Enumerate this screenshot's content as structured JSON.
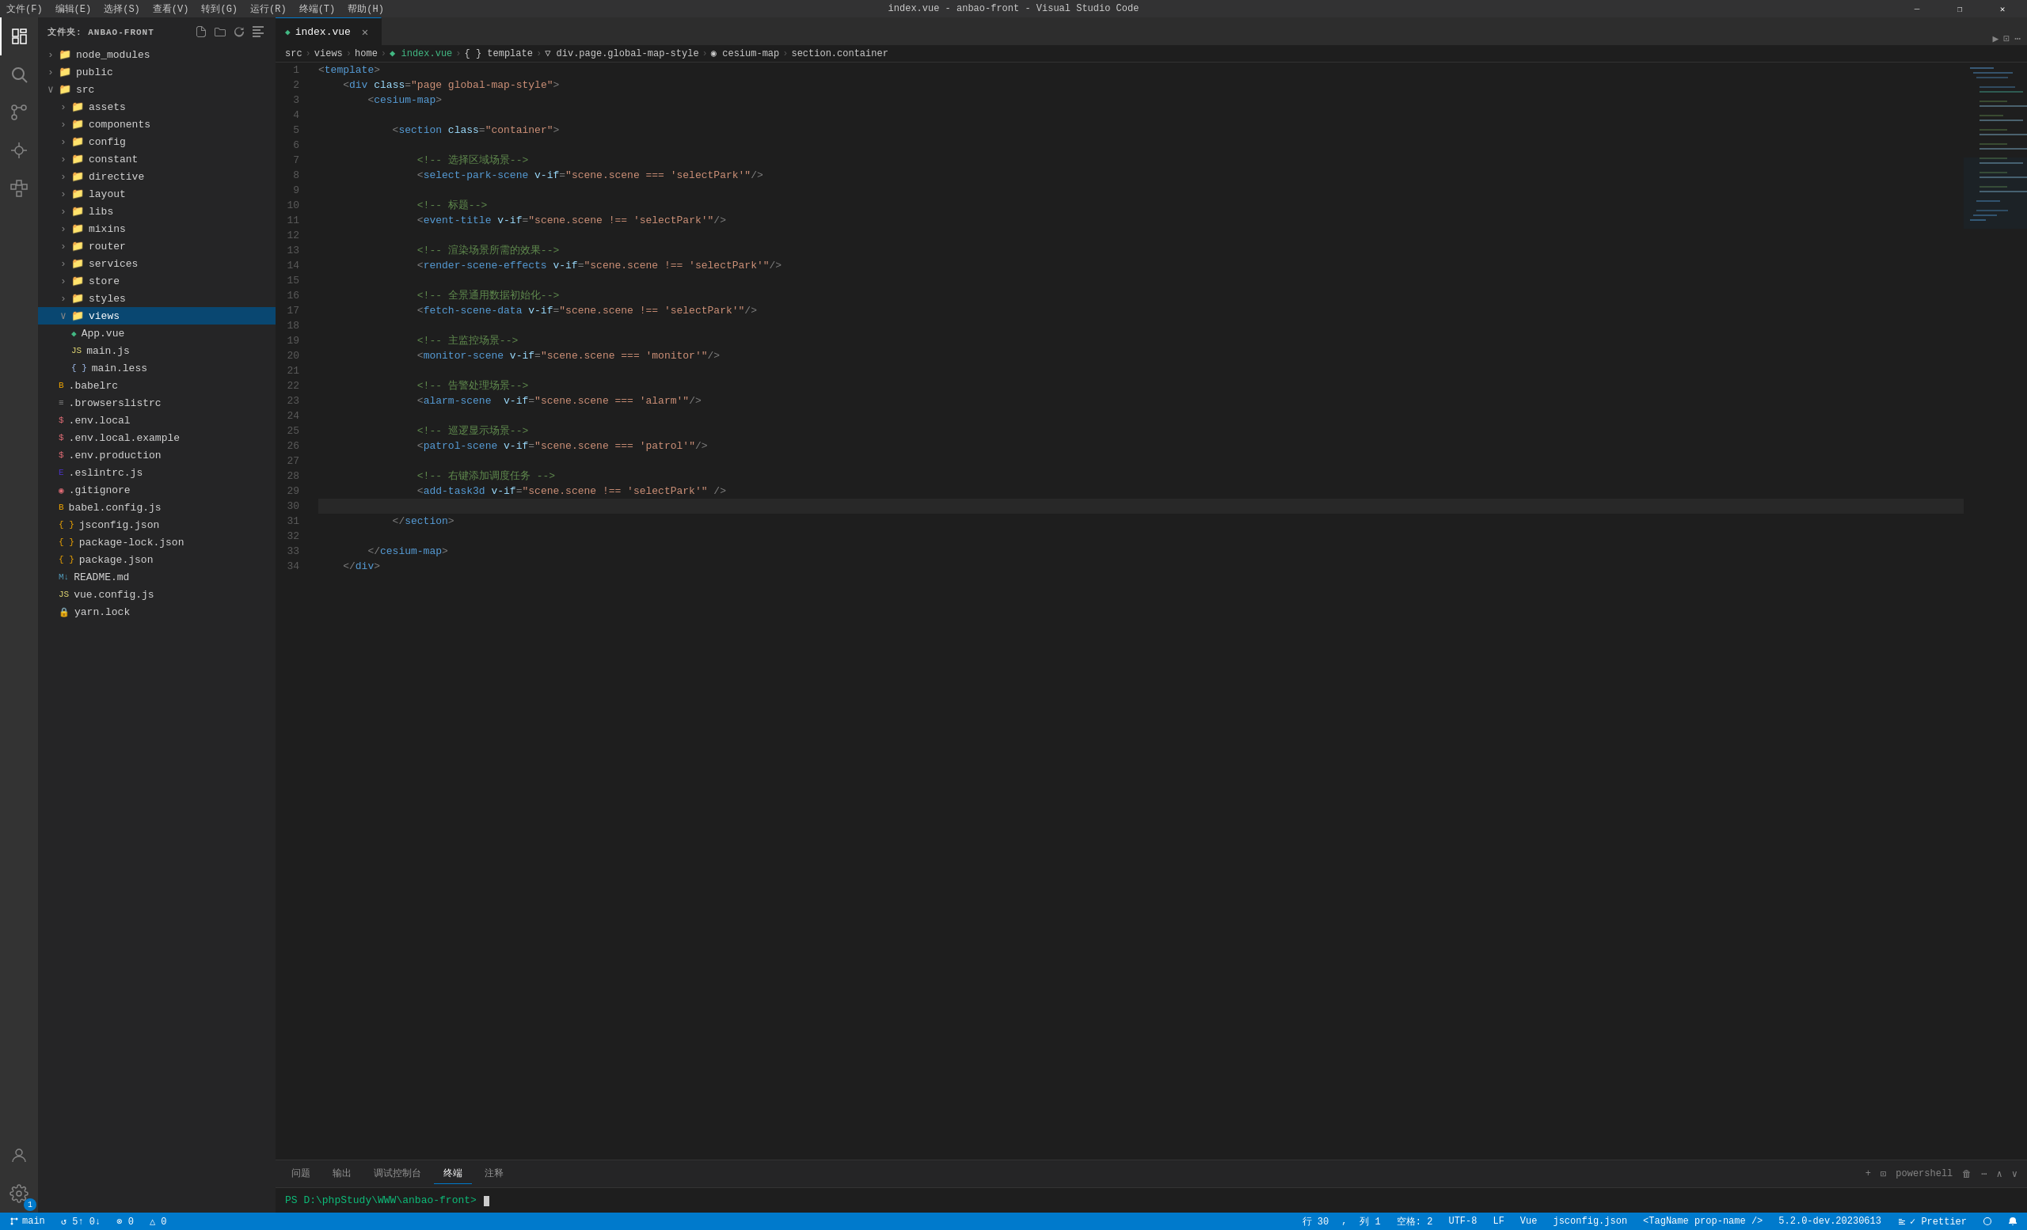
{
  "titleBar": {
    "menus": [
      "文件(F)",
      "编辑(E)",
      "选择(S)",
      "查看(V)",
      "转到(G)",
      "运行(R)",
      "终端(T)",
      "帮助(H)"
    ],
    "title": "index.vue - anbao-front - Visual Studio Code",
    "controls": [
      "—",
      "❐",
      "✕"
    ]
  },
  "sidebar": {
    "header": "文件夹: ANBAO-FRONT",
    "tree": [
      {
        "id": "node_modules",
        "label": "node_modules",
        "type": "folder",
        "depth": 0,
        "collapsed": true
      },
      {
        "id": "public",
        "label": "public",
        "type": "folder",
        "depth": 0,
        "collapsed": true
      },
      {
        "id": "src",
        "label": "src",
        "type": "folder",
        "depth": 0,
        "collapsed": false
      },
      {
        "id": "assets",
        "label": "assets",
        "type": "folder",
        "depth": 1,
        "collapsed": true
      },
      {
        "id": "components",
        "label": "components",
        "type": "folder",
        "depth": 1,
        "collapsed": true
      },
      {
        "id": "config",
        "label": "config",
        "type": "folder",
        "depth": 1,
        "collapsed": true
      },
      {
        "id": "constant",
        "label": "constant",
        "type": "folder",
        "depth": 1,
        "collapsed": true
      },
      {
        "id": "directive",
        "label": "directive",
        "type": "folder",
        "depth": 1,
        "collapsed": true
      },
      {
        "id": "layout",
        "label": "layout",
        "type": "folder",
        "depth": 1,
        "collapsed": true
      },
      {
        "id": "libs",
        "label": "libs",
        "type": "folder",
        "depth": 1,
        "collapsed": true
      },
      {
        "id": "mixins",
        "label": "mixins",
        "type": "folder",
        "depth": 1,
        "collapsed": true
      },
      {
        "id": "router",
        "label": "router",
        "type": "folder",
        "depth": 1,
        "collapsed": true
      },
      {
        "id": "services",
        "label": "services",
        "type": "folder",
        "depth": 1,
        "collapsed": true
      },
      {
        "id": "store",
        "label": "store",
        "type": "folder",
        "depth": 1,
        "collapsed": true
      },
      {
        "id": "styles",
        "label": "styles",
        "type": "folder",
        "depth": 1,
        "collapsed": true
      },
      {
        "id": "views",
        "label": "views",
        "type": "folder",
        "depth": 1,
        "collapsed": false,
        "selected": true
      },
      {
        "id": "App.vue",
        "label": "App.vue",
        "type": "vue",
        "depth": 1
      },
      {
        "id": "main.js",
        "label": "main.js",
        "type": "js",
        "depth": 1
      },
      {
        "id": "main.less",
        "label": "main.less",
        "type": "less",
        "depth": 1
      },
      {
        "id": ".babelrc",
        "label": ".babelrc",
        "type": "babel",
        "depth": 0
      },
      {
        "id": ".browserslistrc",
        "label": ".browserslistrc",
        "type": "plain",
        "depth": 0
      },
      {
        "id": ".env.local",
        "label": ".env.local",
        "type": "env",
        "depth": 0
      },
      {
        "id": ".env.local.example",
        "label": ".env.local.example",
        "type": "env",
        "depth": 0
      },
      {
        "id": ".env.production",
        "label": ".env.production",
        "type": "env",
        "depth": 0
      },
      {
        "id": ".eslintrc.js",
        "label": ".eslintrc.js",
        "type": "eslint",
        "depth": 0
      },
      {
        "id": ".gitignore",
        "label": ".gitignore",
        "type": "git",
        "depth": 0
      },
      {
        "id": "babel.config.js",
        "label": "babel.config.js",
        "type": "babel",
        "depth": 0
      },
      {
        "id": "jsconfig.json",
        "label": "jsconfig.json",
        "type": "json",
        "depth": 0
      },
      {
        "id": "package-lock.json",
        "label": "package-lock.json",
        "type": "json",
        "depth": 0
      },
      {
        "id": "package.json",
        "label": "package.json",
        "type": "json",
        "depth": 0
      },
      {
        "id": "README.md",
        "label": "README.md",
        "type": "md",
        "depth": 0
      },
      {
        "id": "vue.config.js",
        "label": "vue.config.js",
        "type": "js",
        "depth": 0
      },
      {
        "id": "yarn.lock",
        "label": "yarn.lock",
        "type": "lock",
        "depth": 0
      }
    ]
  },
  "editor": {
    "tabs": [
      {
        "label": "index.vue",
        "active": true,
        "type": "vue"
      }
    ],
    "breadcrumb": [
      "src",
      "views",
      "home",
      "index.vue",
      "{ } template",
      "div.page.global-map-style",
      "cesium-map",
      "section.container"
    ],
    "lines": [
      {
        "num": 1,
        "tokens": [
          {
            "t": "<",
            "c": "tok-punct"
          },
          {
            "t": "template",
            "c": "tok-tag"
          },
          {
            "t": ">",
            "c": "tok-punct"
          }
        ]
      },
      {
        "num": 2,
        "tokens": [
          {
            "t": "    <",
            "c": "tok-punct"
          },
          {
            "t": "div",
            "c": "tok-tag"
          },
          {
            "t": " ",
            "c": "tok-plain"
          },
          {
            "t": "class",
            "c": "tok-attr"
          },
          {
            "t": "=",
            "c": "tok-punct"
          },
          {
            "t": "\"page global-map-style\"",
            "c": "tok-val"
          },
          {
            "t": ">",
            "c": "tok-punct"
          }
        ]
      },
      {
        "num": 3,
        "tokens": [
          {
            "t": "        <",
            "c": "tok-punct"
          },
          {
            "t": "cesium-map",
            "c": "tok-tag"
          },
          {
            "t": ">",
            "c": "tok-punct"
          }
        ]
      },
      {
        "num": 4,
        "tokens": []
      },
      {
        "num": 5,
        "tokens": [
          {
            "t": "            <",
            "c": "tok-punct"
          },
          {
            "t": "section",
            "c": "tok-tag"
          },
          {
            "t": " ",
            "c": "tok-plain"
          },
          {
            "t": "class",
            "c": "tok-attr"
          },
          {
            "t": "=",
            "c": "tok-punct"
          },
          {
            "t": "\"container\"",
            "c": "tok-val"
          },
          {
            "t": ">",
            "c": "tok-punct"
          }
        ]
      },
      {
        "num": 6,
        "tokens": []
      },
      {
        "num": 7,
        "tokens": [
          {
            "t": "                <!-- 选择区域场景-->",
            "c": "tok-comment"
          }
        ]
      },
      {
        "num": 8,
        "tokens": [
          {
            "t": "                <",
            "c": "tok-punct"
          },
          {
            "t": "select-park-scene",
            "c": "tok-tag"
          },
          {
            "t": " ",
            "c": "tok-plain"
          },
          {
            "t": "v-if",
            "c": "tok-attr"
          },
          {
            "t": "=",
            "c": "tok-punct"
          },
          {
            "t": "\"scene.scene === 'selectPark'\"",
            "c": "tok-val"
          },
          {
            "t": "/>",
            "c": "tok-punct"
          }
        ]
      },
      {
        "num": 9,
        "tokens": []
      },
      {
        "num": 10,
        "tokens": [
          {
            "t": "                <!-- 标题-->",
            "c": "tok-comment"
          }
        ]
      },
      {
        "num": 11,
        "tokens": [
          {
            "t": "                <",
            "c": "tok-punct"
          },
          {
            "t": "event-title",
            "c": "tok-tag"
          },
          {
            "t": " ",
            "c": "tok-plain"
          },
          {
            "t": "v-if",
            "c": "tok-attr"
          },
          {
            "t": "=",
            "c": "tok-punct"
          },
          {
            "t": "\"scene.scene !== 'selectPark'\"",
            "c": "tok-val"
          },
          {
            "t": "/>",
            "c": "tok-punct"
          }
        ]
      },
      {
        "num": 12,
        "tokens": []
      },
      {
        "num": 13,
        "tokens": [
          {
            "t": "                <!-- 渲染场景所需的效果-->",
            "c": "tok-comment"
          }
        ]
      },
      {
        "num": 14,
        "tokens": [
          {
            "t": "                <",
            "c": "tok-punct"
          },
          {
            "t": "render-scene-effects",
            "c": "tok-tag"
          },
          {
            "t": " ",
            "c": "tok-plain"
          },
          {
            "t": "v-if",
            "c": "tok-attr"
          },
          {
            "t": "=",
            "c": "tok-punct"
          },
          {
            "t": "\"scene.scene !== 'selectPark'\"",
            "c": "tok-val"
          },
          {
            "t": "/>",
            "c": "tok-punct"
          }
        ]
      },
      {
        "num": 15,
        "tokens": []
      },
      {
        "num": 16,
        "tokens": [
          {
            "t": "                <!-- 全景通用数据初始化-->",
            "c": "tok-comment"
          }
        ]
      },
      {
        "num": 17,
        "tokens": [
          {
            "t": "                <",
            "c": "tok-punct"
          },
          {
            "t": "fetch-scene-data",
            "c": "tok-tag"
          },
          {
            "t": " ",
            "c": "tok-plain"
          },
          {
            "t": "v-if",
            "c": "tok-attr"
          },
          {
            "t": "=",
            "c": "tok-punct"
          },
          {
            "t": "\"scene.scene !== 'selectPark'\"",
            "c": "tok-val"
          },
          {
            "t": "/>",
            "c": "tok-punct"
          }
        ]
      },
      {
        "num": 18,
        "tokens": []
      },
      {
        "num": 19,
        "tokens": [
          {
            "t": "                <!-- 主监控场景-->",
            "c": "tok-comment"
          }
        ]
      },
      {
        "num": 20,
        "tokens": [
          {
            "t": "                <",
            "c": "tok-punct"
          },
          {
            "t": "monitor-scene",
            "c": "tok-tag"
          },
          {
            "t": " ",
            "c": "tok-plain"
          },
          {
            "t": "v-if",
            "c": "tok-attr"
          },
          {
            "t": "=",
            "c": "tok-punct"
          },
          {
            "t": "\"scene.scene === 'monitor'\"",
            "c": "tok-val"
          },
          {
            "t": "/>",
            "c": "tok-punct"
          }
        ]
      },
      {
        "num": 21,
        "tokens": []
      },
      {
        "num": 22,
        "tokens": [
          {
            "t": "                <!-- 告警处理场景-->",
            "c": "tok-comment"
          }
        ]
      },
      {
        "num": 23,
        "tokens": [
          {
            "t": "                <",
            "c": "tok-punct"
          },
          {
            "t": "alarm-scene",
            "c": "tok-tag"
          },
          {
            "t": "  ",
            "c": "tok-plain"
          },
          {
            "t": "v-if",
            "c": "tok-attr"
          },
          {
            "t": "=",
            "c": "tok-punct"
          },
          {
            "t": "\"scene.scene === 'alarm'\"",
            "c": "tok-val"
          },
          {
            "t": "/>",
            "c": "tok-punct"
          }
        ]
      },
      {
        "num": 24,
        "tokens": []
      },
      {
        "num": 25,
        "tokens": [
          {
            "t": "                <!-- 巡逻显示场景-->",
            "c": "tok-comment"
          }
        ]
      },
      {
        "num": 26,
        "tokens": [
          {
            "t": "                <",
            "c": "tok-punct"
          },
          {
            "t": "patrol-scene",
            "c": "tok-tag"
          },
          {
            "t": " ",
            "c": "tok-plain"
          },
          {
            "t": "v-if",
            "c": "tok-attr"
          },
          {
            "t": "=",
            "c": "tok-punct"
          },
          {
            "t": "\"scene.scene === 'patrol'\"",
            "c": "tok-val"
          },
          {
            "t": "/>",
            "c": "tok-punct"
          }
        ]
      },
      {
        "num": 27,
        "tokens": []
      },
      {
        "num": 28,
        "tokens": [
          {
            "t": "                <!-- 右键添加调度任务 -->",
            "c": "tok-comment"
          }
        ]
      },
      {
        "num": 29,
        "tokens": [
          {
            "t": "                <",
            "c": "tok-punct"
          },
          {
            "t": "add-task3d",
            "c": "tok-tag"
          },
          {
            "t": " ",
            "c": "tok-plain"
          },
          {
            "t": "v-if",
            "c": "tok-attr"
          },
          {
            "t": "=",
            "c": "tok-punct"
          },
          {
            "t": "\"scene.scene !== 'selectPark'\"",
            "c": "tok-val"
          },
          {
            "t": " />",
            "c": "tok-punct"
          }
        ]
      },
      {
        "num": 30,
        "tokens": [],
        "current": true
      },
      {
        "num": 31,
        "tokens": [
          {
            "t": "            </",
            "c": "tok-punct"
          },
          {
            "t": "section",
            "c": "tok-tag"
          },
          {
            "t": ">",
            "c": "tok-punct"
          }
        ]
      },
      {
        "num": 32,
        "tokens": []
      },
      {
        "num": 33,
        "tokens": [
          {
            "t": "        </",
            "c": "tok-punct"
          },
          {
            "t": "cesium-map",
            "c": "tok-tag"
          },
          {
            "t": ">",
            "c": "tok-punct"
          }
        ]
      },
      {
        "num": 34,
        "tokens": [
          {
            "t": "    </",
            "c": "tok-punct"
          },
          {
            "t": "div",
            "c": "tok-tag"
          },
          {
            "t": ">",
            "c": "tok-punct"
          }
        ]
      }
    ]
  },
  "terminal": {
    "tabs": [
      "问题",
      "输出",
      "调试控制台",
      "终端",
      "注释"
    ],
    "activeTab": "终端",
    "shellLabel": "powershell",
    "prompt": "PS D:\\phpStudy\\WWW\\anbao-front>"
  },
  "statusBar": {
    "branch": "main",
    "sync": "↺ 5↑ 0↓",
    "errors": "⊗ 0",
    "warnings": "△ 0",
    "row": "行 30",
    "col": "列 1",
    "spaces": "空格: 2",
    "encoding": "UTF-8",
    "eol": "LF",
    "language": "Vue",
    "schema": "jsconfig.json",
    "tagName": "<TagName prop-name />",
    "version": "5.2.0-dev.20230613",
    "prettier": "✓ Prettier"
  }
}
